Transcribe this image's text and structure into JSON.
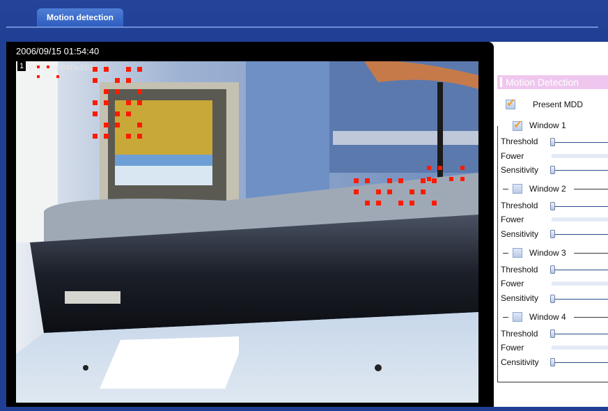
{
  "tabs": {
    "active_label": "Motion detection"
  },
  "video": {
    "timestamp": "2006/09/15 01:54:40",
    "window_number": "1",
    "window_label": "Window 640x480"
  },
  "panel": {
    "title": "Motion Detection",
    "present_label": "Present MDD",
    "present_checked": true,
    "windows": [
      {
        "label": "Window 1",
        "checked": true,
        "threshold_label": "Threshold",
        "power_label": "Fower",
        "sensitivity_label": "Sensitivity",
        "threshold": 0,
        "sensitivity": 0
      },
      {
        "label": "Window 2",
        "checked": false,
        "threshold_label": "Threshold",
        "power_label": "Fower",
        "sensitivity_label": "Sensitivity",
        "threshold": 0,
        "sensitivity": 0
      },
      {
        "label": "Window 3",
        "checked": false,
        "threshold_label": "Threshold",
        "power_label": "Fower",
        "sensitivity_label": "Sensitivity",
        "threshold": 0,
        "sensitivity": 0
      },
      {
        "label": "Window 4",
        "checked": false,
        "threshold_label": "Threshold",
        "power_label": "Fower",
        "sensitivity_label": "Censitivity",
        "threshold": 0,
        "sensitivity": 0
      }
    ]
  },
  "colors": {
    "header": "#1f3f94",
    "tab": "#2e5dbf",
    "panel_title_bg": "#efc7ee",
    "motion_marker": "#ff1a00"
  }
}
